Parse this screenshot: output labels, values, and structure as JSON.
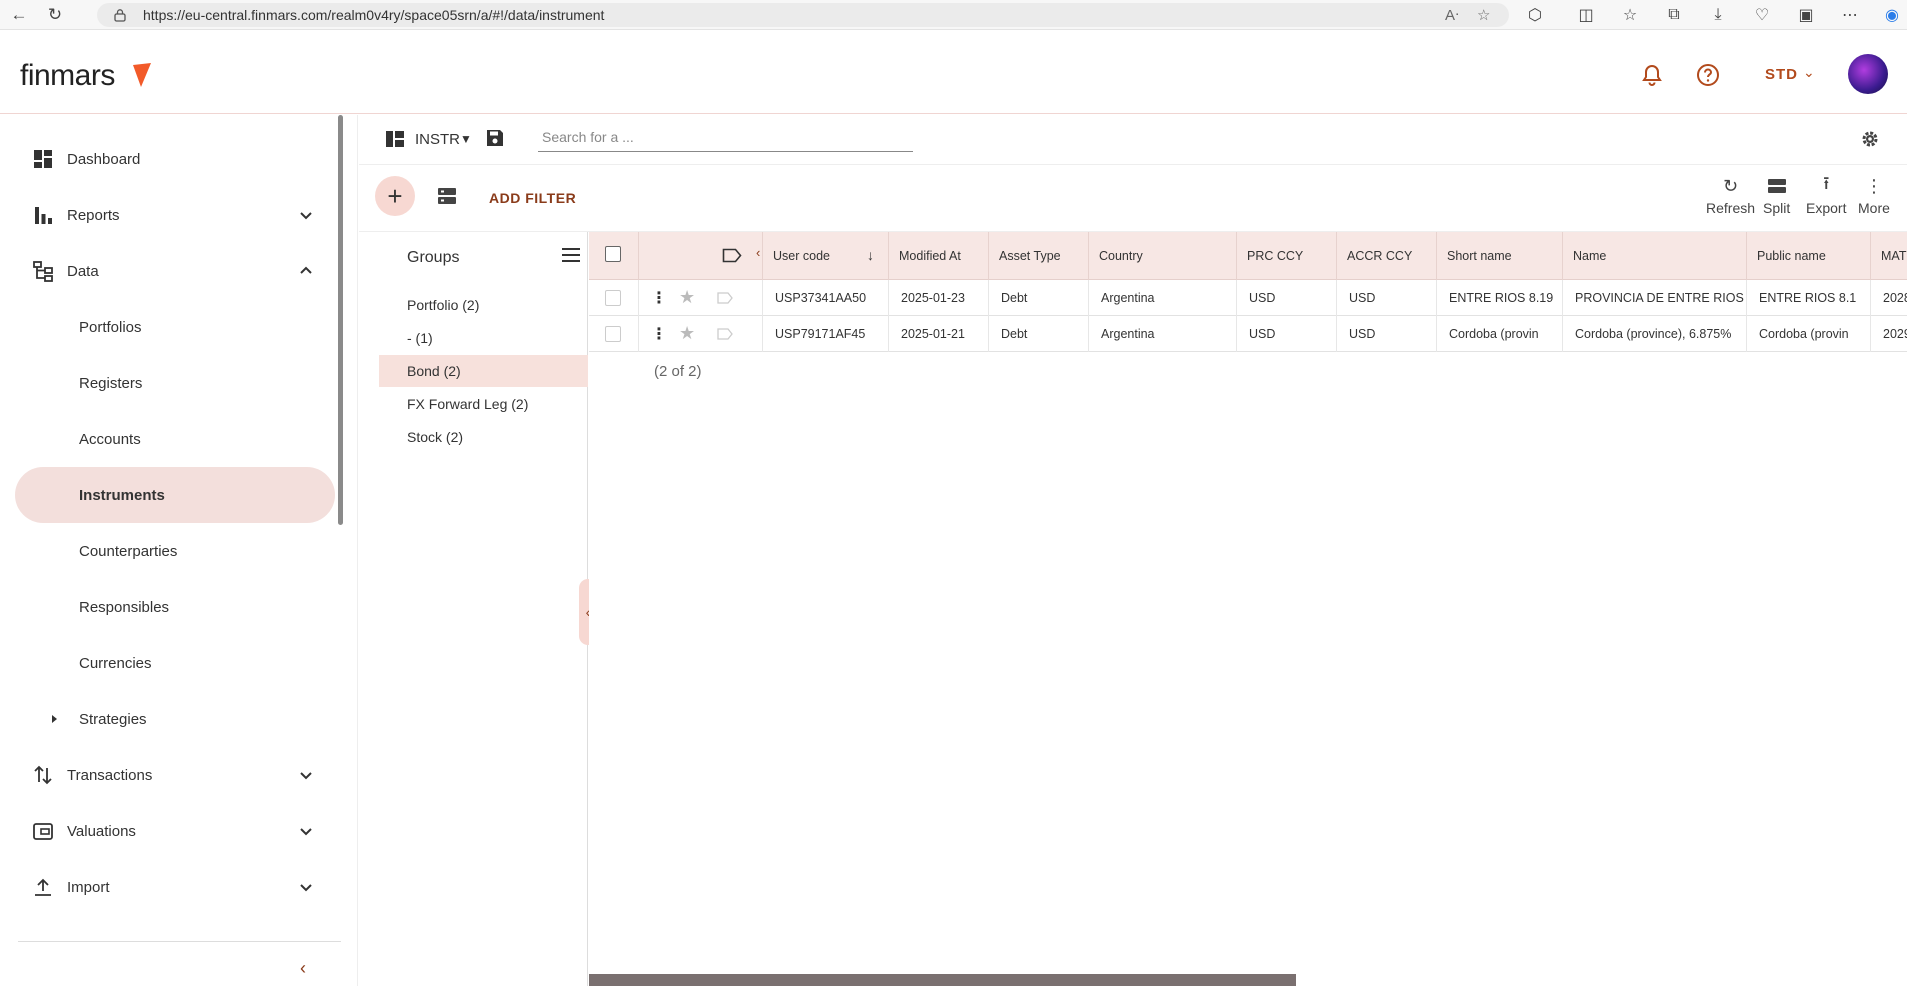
{
  "browser": {
    "url": "https://eu-central.finmars.com/realm0v4ry/space05srn/a/#!/data/instrument"
  },
  "header": {
    "logo_text": "finmars",
    "workspace": "STD"
  },
  "sidebar": {
    "items": [
      {
        "label": "Dashboard"
      },
      {
        "label": "Reports"
      },
      {
        "label": "Data"
      },
      {
        "label": "Portfolios"
      },
      {
        "label": "Registers"
      },
      {
        "label": "Accounts"
      },
      {
        "label": "Instruments"
      },
      {
        "label": "Counterparties"
      },
      {
        "label": "Responsibles"
      },
      {
        "label": "Currencies"
      },
      {
        "label": "Strategies"
      },
      {
        "label": "Transactions"
      },
      {
        "label": "Valuations"
      },
      {
        "label": "Import"
      }
    ]
  },
  "toolbar": {
    "layout_name": "INSTR",
    "search_placeholder": "Search for a ...",
    "add_filter": "ADD FILTER",
    "actions": {
      "refresh": "Refresh",
      "split": "Split",
      "export": "Export",
      "more": "More"
    }
  },
  "groups": {
    "title": "Groups",
    "items": [
      {
        "label": "Portfolio (2)"
      },
      {
        "label": "- (1)"
      },
      {
        "label": "Bond (2)"
      },
      {
        "label": "FX Forward Leg (2)"
      },
      {
        "label": "Stock (2)"
      }
    ],
    "selected": "Bond (2)"
  },
  "table": {
    "columns": [
      "User code",
      "Modified At",
      "Asset Type",
      "Country",
      "PRC CCY",
      "ACCR CCY",
      "Short name",
      "Name",
      "Public name",
      "MAT"
    ],
    "rows": [
      [
        "USP37341AA50",
        "2025-01-23",
        "Debt",
        "Argentina",
        "USD",
        "USD",
        "ENTRE RIOS 8.19",
        "PROVINCIA DE ENTRE RIOS",
        "ENTRE RIOS  8.1",
        "2028"
      ],
      [
        "USP79171AF45",
        "2025-01-21",
        "Debt",
        "Argentina",
        "USD",
        "USD",
        "Cordoba (provin",
        "Cordoba (province), 6.875%",
        "Cordoba (provin",
        "2029"
      ]
    ],
    "count_text": "(2 of 2)"
  },
  "colors": {
    "accent": "#8a3b1a",
    "active_bg": "#f3dfdc",
    "header_bg": "#f7e7e4"
  }
}
